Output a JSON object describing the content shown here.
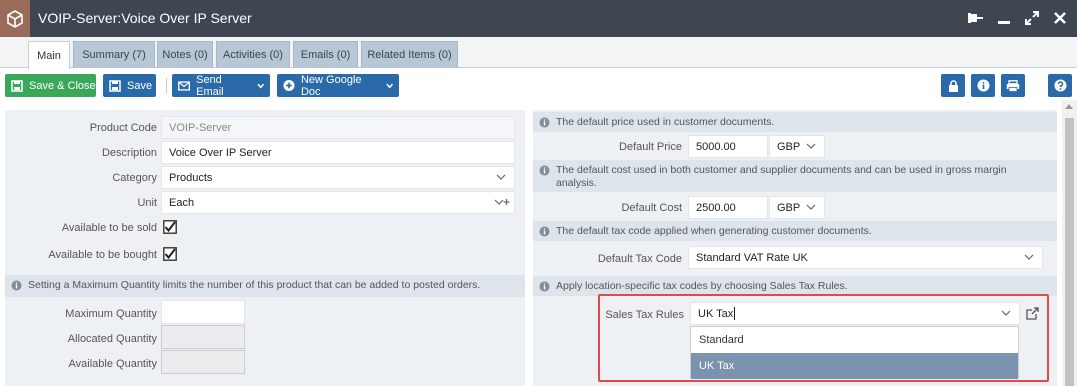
{
  "window": {
    "title": "VOIP-Server:Voice Over IP Server"
  },
  "tabs": [
    {
      "label": "Main"
    },
    {
      "label": "Summary (7)"
    },
    {
      "label": "Notes (0)"
    },
    {
      "label": "Activities (0)"
    },
    {
      "label": "Emails (0)"
    },
    {
      "label": "Related Items (0)"
    }
  ],
  "toolbar": {
    "save_close": "Save & Close",
    "save": "Save",
    "send_email": "Send Email",
    "new_google_doc": "New Google Doc"
  },
  "left": {
    "product_code": {
      "label": "Product Code",
      "value": "VOIP-Server"
    },
    "description": {
      "label": "Description",
      "value": "Voice Over IP Server"
    },
    "category": {
      "label": "Category",
      "value": "Products"
    },
    "unit": {
      "label": "Unit",
      "value": "Each"
    },
    "available_sold": {
      "label": "Available to be sold",
      "checked": true
    },
    "available_bought": {
      "label": "Available to be bought",
      "checked": true
    },
    "info_max_qty": "Setting a Maximum Quantity limits the number of this product that can be added to posted orders.",
    "maximum_quantity": {
      "label": "Maximum Quantity",
      "value": ""
    },
    "allocated_quantity": {
      "label": "Allocated Quantity",
      "value": ""
    },
    "available_quantity": {
      "label": "Available Quantity",
      "value": ""
    }
  },
  "right": {
    "info_price": "The default price used in customer documents.",
    "default_price": {
      "label": "Default Price",
      "value": "5000.00",
      "currency": "GBP"
    },
    "info_cost": "The default cost used in both customer and supplier documents and can be used in gross margin analysis.",
    "default_cost": {
      "label": "Default Cost",
      "value": "2500.00",
      "currency": "GBP"
    },
    "info_tax": "The default tax code applied when generating customer documents.",
    "default_tax_code": {
      "label": "Default Tax Code",
      "value": "Standard VAT Rate UK"
    },
    "info_location_tax": "Apply location-specific tax codes by choosing Sales Tax Rules.",
    "sales_tax_rules": {
      "label": "Sales Tax Rules",
      "value": "UK Tax"
    },
    "sales_tax_options": [
      "Standard",
      "UK Tax"
    ],
    "selected_option": "UK Tax"
  },
  "colors": {
    "titlebar": "#3f4652",
    "accent_blue": "#2b6aa8",
    "accent_green": "#3aa75a",
    "highlight_red": "#e04a4a",
    "selected_option": "#7b93ae"
  }
}
